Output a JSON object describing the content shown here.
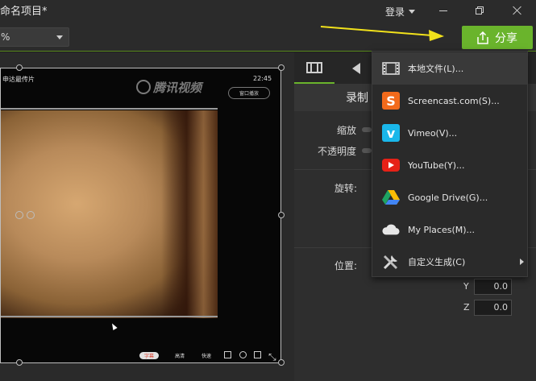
{
  "window": {
    "title": "命名项目*",
    "login_label": "登录"
  },
  "toolbar": {
    "zoom_value": "%",
    "share_label": "分享"
  },
  "video": {
    "title_text": "申达最传片",
    "time_text": "22:45",
    "logo_text": "腾讯视频",
    "popout_text": "窗口播放",
    "badge_text": "字幕",
    "ctl_a": "高清",
    "ctl_b": "快速"
  },
  "panel": {
    "header": "录制",
    "scale_label": "缩放",
    "opacity_label": "不透明度",
    "rotation_label": "旋转:",
    "position_label": "位置:",
    "y_label": "Y",
    "y_value": "0.0",
    "z_label": "Z",
    "z_value": "0.0"
  },
  "menu": {
    "items": [
      {
        "label": "本地文件(L)...",
        "icon": "film-icon"
      },
      {
        "label": "Screencast.com(S)...",
        "icon": "screencast-icon"
      },
      {
        "label": "Vimeo(V)...",
        "icon": "vimeo-icon"
      },
      {
        "label": "YouTube(Y)...",
        "icon": "youtube-icon"
      },
      {
        "label": "Google Drive(G)...",
        "icon": "google-drive-icon"
      },
      {
        "label": "My Places(M)...",
        "icon": "cloud-icon"
      },
      {
        "label": "自定义生成(C)",
        "icon": "tools-icon"
      }
    ]
  },
  "colors": {
    "accent": "#6ab42c",
    "arrow": "#f2e21b",
    "screencast": "#f26a1b",
    "vimeo": "#1ab7ea",
    "youtube": "#e62117"
  }
}
